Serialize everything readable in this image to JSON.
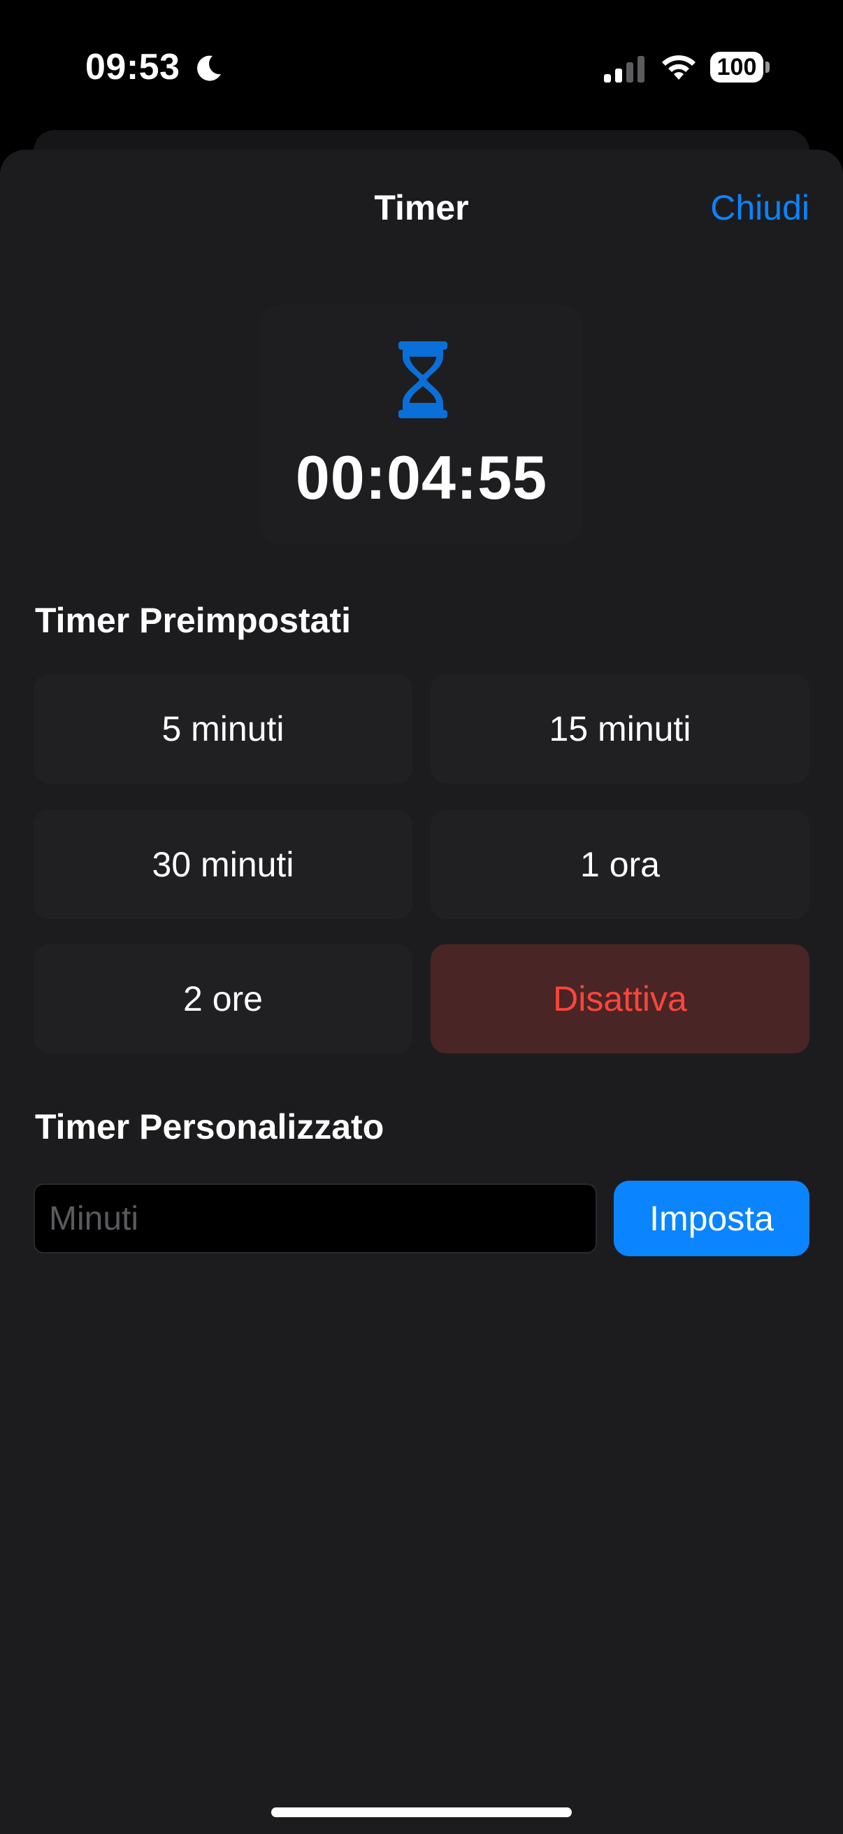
{
  "status_bar": {
    "time": "09:53",
    "battery": "100",
    "icons": [
      "moon-icon",
      "signal-icon",
      "wifi-icon",
      "battery-icon"
    ]
  },
  "nav": {
    "title": "Timer",
    "close_label": "Chiudi"
  },
  "timer": {
    "icon": "hourglass-icon",
    "remaining": "00:04:55"
  },
  "presets": {
    "title": "Timer Preimpostati",
    "items": [
      {
        "label": "5 minuti"
      },
      {
        "label": "15 minuti"
      },
      {
        "label": "30 minuti"
      },
      {
        "label": "1 ora"
      },
      {
        "label": "2 ore"
      },
      {
        "label": "Disattiva"
      }
    ]
  },
  "custom": {
    "title": "Timer Personalizzato",
    "placeholder": "Minuti",
    "value": "",
    "button_label": "Imposta"
  },
  "colors": {
    "accent": "#0a84ff",
    "danger": "#ff453a",
    "danger_bg": "#4a2526",
    "sheet_bg": "#1c1c1e"
  }
}
